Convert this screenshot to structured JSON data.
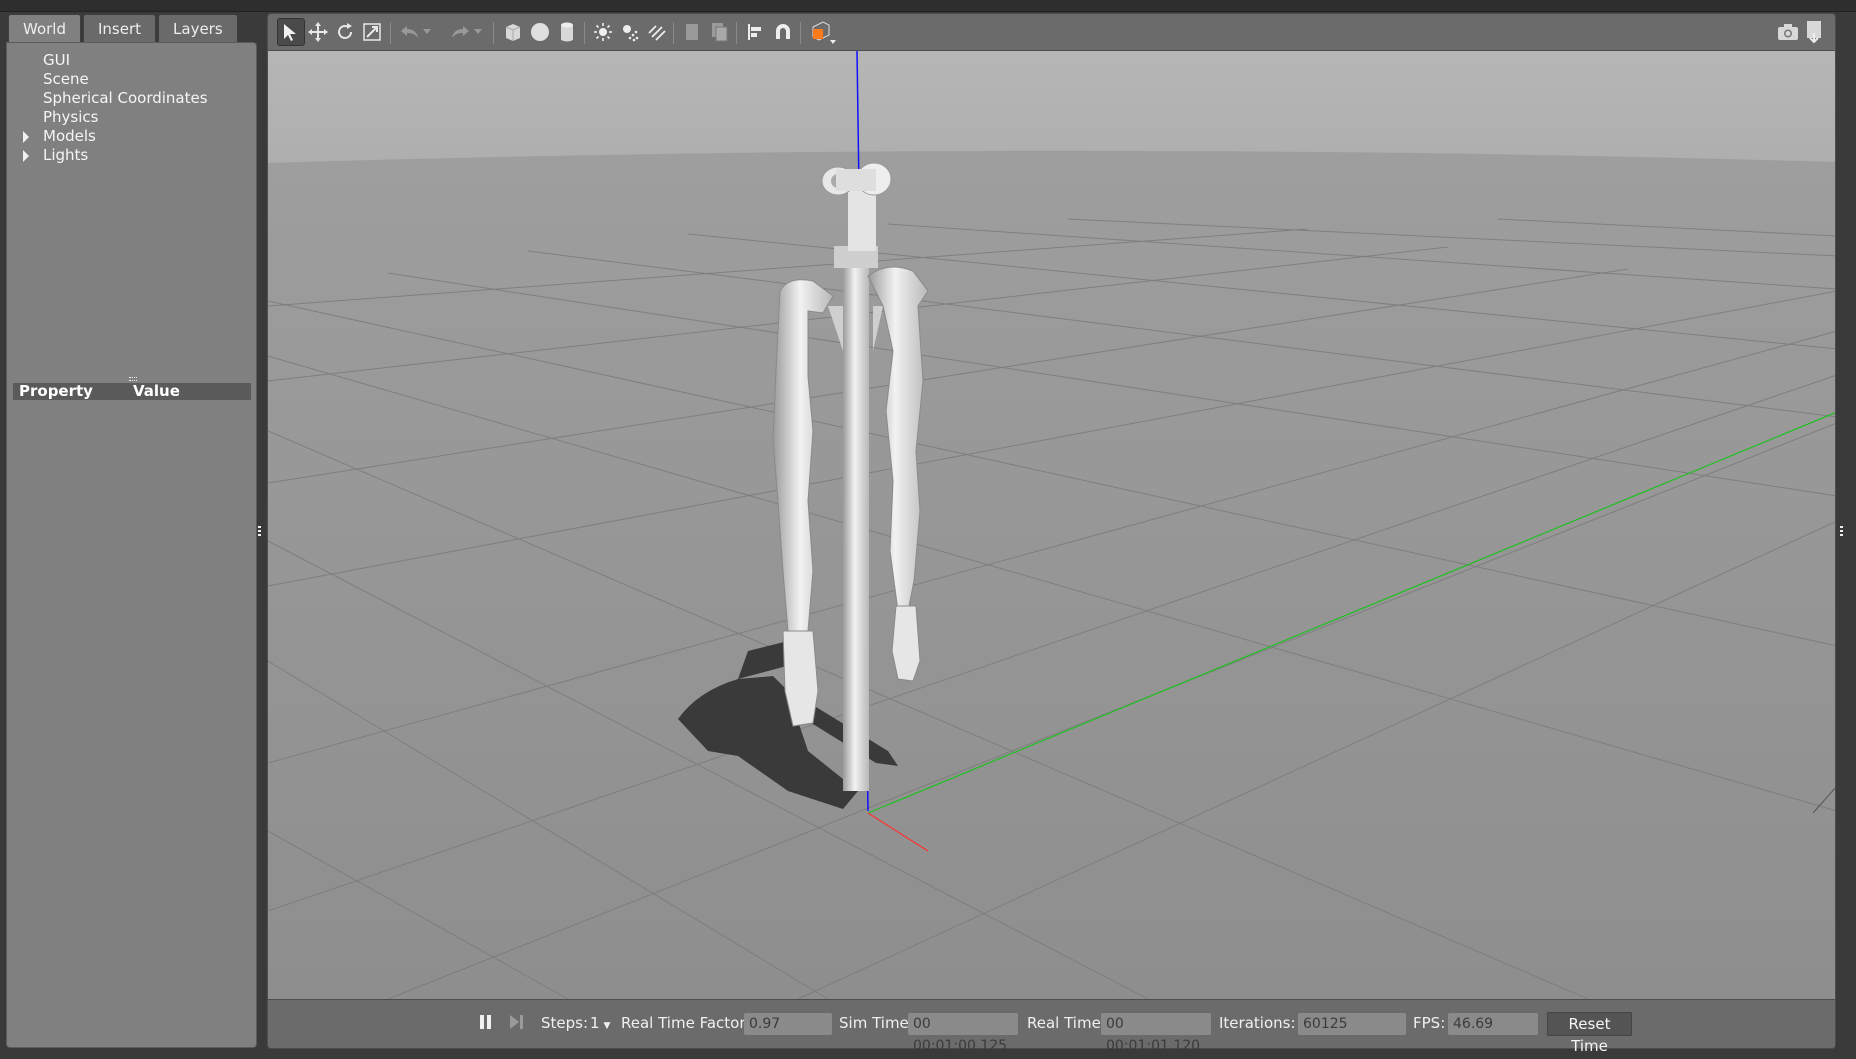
{
  "tabs": [
    {
      "label": "World"
    },
    {
      "label": "Insert"
    },
    {
      "label": "Layers"
    }
  ],
  "tree": [
    {
      "label": "GUI"
    },
    {
      "label": "Scene"
    },
    {
      "label": "Spherical Coordinates"
    },
    {
      "label": "Physics"
    },
    {
      "label": "Models"
    },
    {
      "label": "Lights"
    }
  ],
  "properties": {
    "col_property": "Property",
    "col_value": "Value"
  },
  "toolbar": {
    "tools": [
      "select-mode",
      "translate-mode",
      "rotate-mode",
      "scale-mode",
      "undo",
      "redo",
      "box",
      "sphere",
      "cylinder",
      "point-light",
      "spot-light",
      "directional-light",
      "copy",
      "paste",
      "align",
      "snap",
      "view-angle",
      "screenshot",
      "log"
    ]
  },
  "bottom": {
    "steps_label": "Steps:",
    "steps_value": "1",
    "rtf_label": "Real Time Factor:",
    "rtf_value": "0.97",
    "sim_label": "Sim Time:",
    "sim_value": "00 00:01:00.125",
    "real_label": "Real Time:",
    "real_value": "00 00:01:01.120",
    "iter_label": "Iterations:",
    "iter_value": "60125",
    "fps_label": "FPS:",
    "fps_value": "46.69",
    "reset_label": "Reset Time"
  },
  "colors": {
    "axis_x": "#ff3030",
    "axis_y": "#20c020",
    "axis_z": "#1010ff",
    "accent_orange": "#ff7a1a"
  }
}
